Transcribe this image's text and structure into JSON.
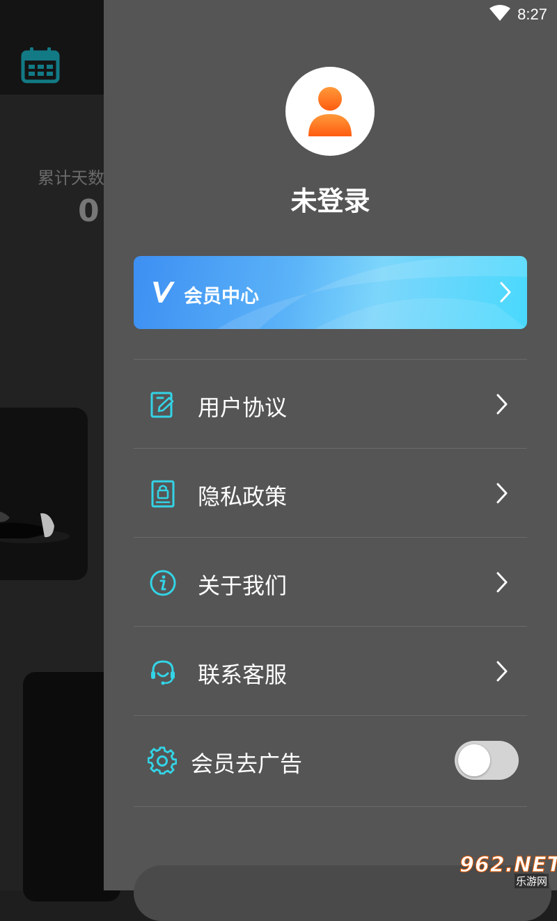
{
  "status_bar": {
    "time": "8:27",
    "icons": [
      "wifi-icon"
    ]
  },
  "background": {
    "stat_label": "累计天数",
    "stat_value": "0",
    "icons": [
      "calendar-icon"
    ]
  },
  "drawer": {
    "avatar_icon": "user-icon",
    "username": "未登录",
    "vip_banner": {
      "label": "会员中心",
      "logo": "v-logo-icon"
    },
    "menu": [
      {
        "label": "用户协议",
        "icon": "edit-document-icon"
      },
      {
        "label": "隐私政策",
        "icon": "lock-document-icon"
      },
      {
        "label": "关于我们",
        "icon": "info-icon"
      },
      {
        "label": "联系客服",
        "icon": "headset-icon"
      }
    ],
    "ad_toggle": {
      "label": "会员去广告",
      "icon": "gear-icon",
      "enabled": false
    }
  },
  "watermark": {
    "brand": "962.NET",
    "subtitle": "乐游网"
  },
  "colors": {
    "accent": "#33d4e6",
    "drawer_bg": "#555555",
    "avatar_orange": "#ff7a1a",
    "vip_gradient_start": "#3d8ff2",
    "vip_gradient_end": "#49d8fd"
  }
}
